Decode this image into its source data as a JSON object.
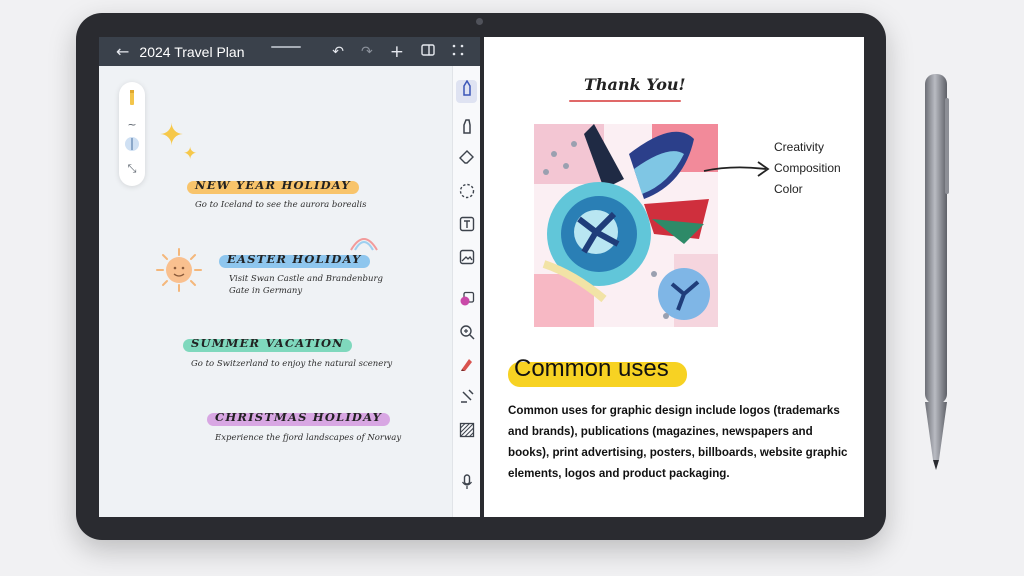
{
  "note_app": {
    "title": "2024 Travel Plan",
    "icons": {
      "back": "arrow-left-icon",
      "undo": "undo-icon",
      "redo": "redo-icon",
      "add": "plus-icon",
      "layout": "split-layout-icon",
      "more": "more-icon"
    },
    "entries": [
      {
        "title": "NEW YEAR HOLIDAY",
        "desc": "Go to Iceland to see the aurora borealis",
        "highlight": "#f8c46b"
      },
      {
        "title": "EASTER HOLIDAY",
        "desc": "Visit Swan Castle and Brandenburg\nGate in Germany",
        "highlight": "#8ec6ee"
      },
      {
        "title": "SUMMER VACATION",
        "desc": "Go to Switzerland to enjoy the natural scenery",
        "highlight": "#7fd8bd"
      },
      {
        "title": "CHRISTMAS HOLIDAY",
        "desc": "Experience the fjord landscapes of Norway",
        "highlight": "#d8a7e3"
      }
    ],
    "toolbar": [
      "pen-icon",
      "highlighter-icon",
      "eraser-icon",
      "lasso-icon",
      "text-icon",
      "image-icon",
      "shape-icon",
      "zoom-icon",
      "marker-icon",
      "stamp-icon",
      "texture-icon",
      "microphone-icon"
    ]
  },
  "document": {
    "thank_you": "Thank You!",
    "labels": [
      "Creativity",
      "Composition",
      "Color"
    ],
    "heading": "Common uses",
    "body": "Common uses for graphic design include logos (trademarks and brands), publications (magazines, newspapers and books), print advertising, posters, billboards, website graphic elements, logos and product packaging."
  },
  "colors": {
    "topbar": "#3a414b",
    "bezel": "#2a2b30",
    "heading_highlight": "#f7d223",
    "thank_underline": "#e06868"
  }
}
